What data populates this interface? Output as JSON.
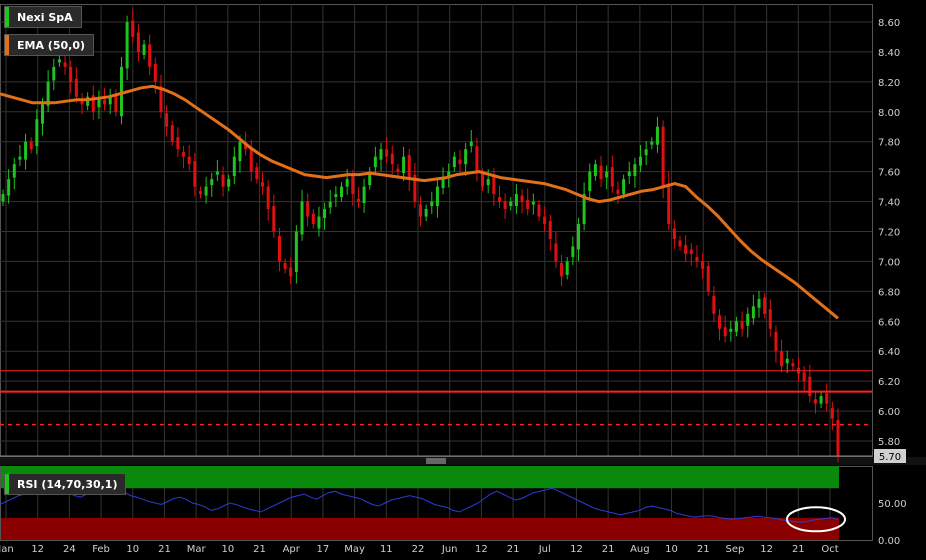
{
  "legends": {
    "price": {
      "label": "Nexi SpA",
      "color": "#1fc41f"
    },
    "ema": {
      "label": "EMA (50,0)",
      "color": "#e0701a"
    },
    "rsi": {
      "label": "RSI (14,70,30,1)",
      "color": "#1fc41f"
    }
  },
  "price_axis": {
    "ticks": [
      "8.60",
      "8.40",
      "8.20",
      "8.00",
      "7.80",
      "7.60",
      "7.40",
      "7.20",
      "7.00",
      "6.80",
      "6.60",
      "6.40",
      "6.20",
      "6.00",
      "5.80"
    ],
    "last_price_label": "5.70"
  },
  "rsi_axis": {
    "ticks": [
      "50.00",
      "0.00"
    ]
  },
  "time_axis": {
    "labels": [
      "Jan",
      "12",
      "24",
      "Feb",
      "10",
      "21",
      "Mar",
      "10",
      "21",
      "Apr",
      "17",
      "May",
      "11",
      "22",
      "Jun",
      "12",
      "21",
      "Jul",
      "12",
      "21",
      "Aug",
      "10",
      "21",
      "Sep",
      "12",
      "21",
      "Oct"
    ]
  },
  "colors": {
    "background": "#000000",
    "grid": "#333333",
    "up": "#1fc41f",
    "down": "#e01010",
    "ema": "#e0701a",
    "rsi_line": "#2b3bd6",
    "level_line": "#ff2020"
  },
  "chart_data": [
    {
      "type": "candlestick",
      "title": "Nexi SpA",
      "ylim": [
        5.7,
        8.72
      ],
      "grid": true,
      "levels": [
        {
          "value": 6.27,
          "style": "solid"
        },
        {
          "value": 6.13,
          "style": "solid"
        },
        {
          "value": 5.91,
          "style": "dashed"
        }
      ],
      "last_value": 5.7,
      "close": [
        7.45,
        7.55,
        7.65,
        7.7,
        7.8,
        7.75,
        7.95,
        8.05,
        8.2,
        8.3,
        8.35,
        8.3,
        8.2,
        8.1,
        8.05,
        8.1,
        8.0,
        8.1,
        8.05,
        8.1,
        8.0,
        8.3,
        8.6,
        8.5,
        8.4,
        8.45,
        8.3,
        8.2,
        8.0,
        7.9,
        7.8,
        7.75,
        7.7,
        7.65,
        7.5,
        7.45,
        7.5,
        7.55,
        7.6,
        7.5,
        7.55,
        7.7,
        7.8,
        7.75,
        7.6,
        7.55,
        7.5,
        7.35,
        7.2,
        7.0,
        6.95,
        6.9,
        7.2,
        7.4,
        7.3,
        7.25,
        7.3,
        7.35,
        7.4,
        7.45,
        7.5,
        7.55,
        7.45,
        7.4,
        7.5,
        7.6,
        7.7,
        7.75,
        7.7,
        7.65,
        7.6,
        7.7,
        7.55,
        7.4,
        7.3,
        7.35,
        7.4,
        7.5,
        7.55,
        7.6,
        7.7,
        7.65,
        7.75,
        7.8,
        7.6,
        7.5,
        7.55,
        7.45,
        7.4,
        7.35,
        7.4,
        7.45,
        7.4,
        7.35,
        7.4,
        7.3,
        7.25,
        7.15,
        7.0,
        6.9,
        7.0,
        7.1,
        7.25,
        7.45,
        7.6,
        7.65,
        7.55,
        7.6,
        7.5,
        7.45,
        7.55,
        7.6,
        7.65,
        7.7,
        7.75,
        7.8,
        7.9,
        7.5,
        7.25,
        7.15,
        7.1,
        7.05,
        7.05,
        7.0,
        6.95,
        6.8,
        6.65,
        6.55,
        6.5,
        6.55,
        6.6,
        6.55,
        6.65,
        6.7,
        6.75,
        6.65,
        6.55,
        6.4,
        6.3,
        6.35,
        6.3,
        6.25,
        6.2,
        6.1,
        6.05,
        6.1,
        6.05,
        5.95,
        5.7
      ]
    },
    {
      "type": "line",
      "title": "EMA (50,0)",
      "ylim": [
        5.7,
        8.72
      ],
      "values": [
        8.12,
        8.1,
        8.08,
        8.06,
        8.06,
        8.06,
        8.07,
        8.08,
        8.08,
        8.09,
        8.1,
        8.12,
        8.14,
        8.16,
        8.17,
        8.15,
        8.12,
        8.08,
        8.03,
        7.98,
        7.93,
        7.88,
        7.82,
        7.76,
        7.71,
        7.67,
        7.64,
        7.61,
        7.58,
        7.57,
        7.56,
        7.57,
        7.58,
        7.58,
        7.59,
        7.58,
        7.57,
        7.56,
        7.55,
        7.54,
        7.55,
        7.56,
        7.58,
        7.59,
        7.6,
        7.58,
        7.56,
        7.55,
        7.54,
        7.53,
        7.52,
        7.5,
        7.48,
        7.45,
        7.42,
        7.4,
        7.41,
        7.43,
        7.45,
        7.47,
        7.48,
        7.5,
        7.52,
        7.5,
        7.43,
        7.37,
        7.3,
        7.22,
        7.14,
        7.07,
        7.01,
        6.96,
        6.91,
        6.86,
        6.8,
        6.74,
        6.68,
        6.62
      ]
    },
    {
      "type": "line",
      "title": "RSI (14,70,30,1)",
      "ylim": [
        0,
        100
      ],
      "bands": [
        {
          "from": 70,
          "to": 100,
          "color": "#0a8a0a"
        },
        {
          "from": 0,
          "to": 30,
          "color": "#8a0000"
        }
      ],
      "values": [
        48,
        52,
        56,
        60,
        62,
        64,
        66,
        65,
        68,
        70,
        66,
        64,
        60,
        58,
        62,
        66,
        68,
        70,
        72,
        75,
        65,
        60,
        58,
        55,
        52,
        50,
        48,
        52,
        56,
        58,
        55,
        50,
        48,
        45,
        40,
        42,
        46,
        50,
        48,
        45,
        42,
        40,
        38,
        42,
        46,
        50,
        54,
        58,
        60,
        62,
        58,
        55,
        60,
        64,
        66,
        62,
        60,
        58,
        56,
        52,
        48,
        46,
        50,
        54,
        56,
        58,
        60,
        58,
        56,
        52,
        48,
        46,
        44,
        40,
        38,
        42,
        46,
        50,
        56,
        62,
        66,
        62,
        58,
        54,
        56,
        60,
        64,
        66,
        68,
        70,
        66,
        62,
        58,
        54,
        50,
        46,
        42,
        40,
        38,
        36,
        34,
        36,
        38,
        40,
        44,
        46,
        44,
        42,
        40,
        36,
        34,
        32,
        31,
        32,
        33,
        32,
        30,
        29,
        28,
        29,
        30,
        31,
        32,
        31,
        30,
        29,
        27,
        26,
        25,
        24,
        25,
        27,
        28,
        29,
        30,
        28
      ],
      "annotation": "ellipse around final readings"
    }
  ]
}
